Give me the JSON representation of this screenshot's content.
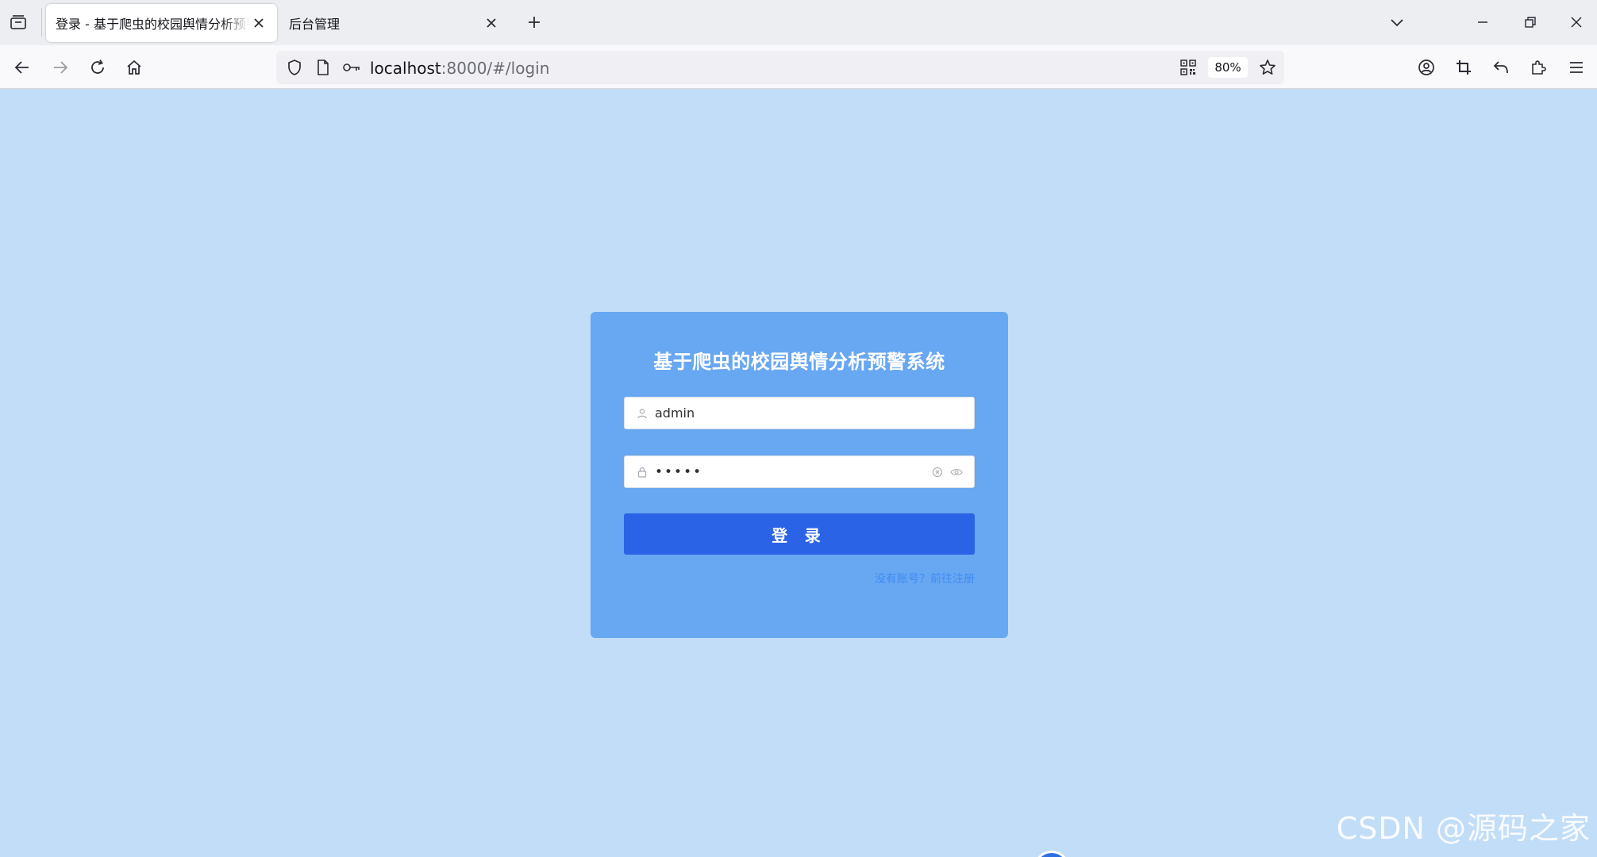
{
  "browser": {
    "tabs": [
      {
        "label": "登录 - 基于爬虫的校园舆情分析预警系统",
        "active": true
      },
      {
        "label": "后台管理",
        "active": false
      }
    ],
    "url": {
      "host": "localhost",
      "rest": ":8000/#/login"
    },
    "zoom": "80%"
  },
  "login": {
    "title": "基于爬虫的校园舆情分析预警系统",
    "username_value": "admin",
    "password_value": "•••••",
    "submit_label": "登 录",
    "register_link": "没有账号？前往注册"
  },
  "watermark": "CSDN @源码之家",
  "colors": {
    "page_bg": "#c2ddf8",
    "card_bg": "#68a7f1",
    "button_bg": "#2b63e6",
    "link": "#3f8cf5"
  }
}
